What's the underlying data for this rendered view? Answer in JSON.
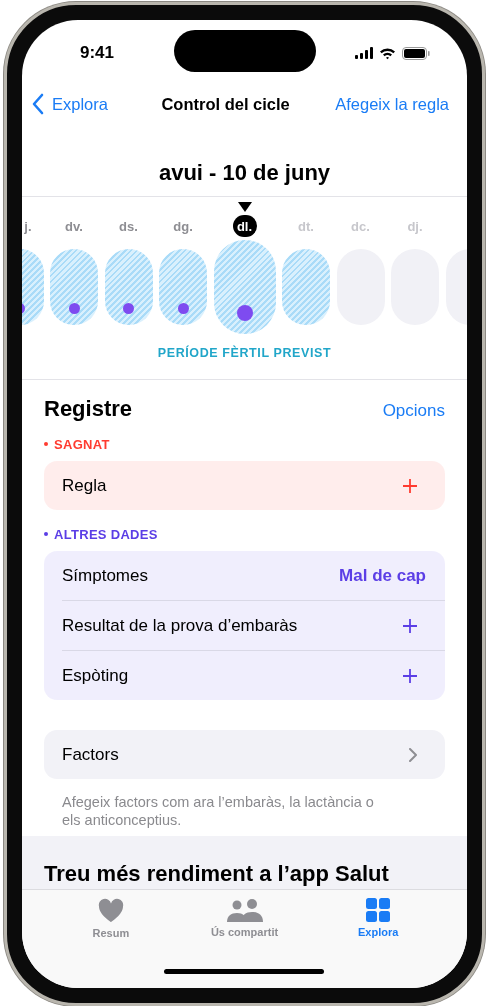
{
  "status_bar": {
    "time": "9:41"
  },
  "nav": {
    "back": "Explora",
    "title": "Control del cicle",
    "action": "Afegeix la regla"
  },
  "date_title": "avui - 10 de juny",
  "days": [
    {
      "label": "j.",
      "fertile": true,
      "logged": true,
      "selected": false,
      "future": false
    },
    {
      "label": "dv.",
      "fertile": true,
      "logged": true,
      "selected": false,
      "future": false
    },
    {
      "label": "ds.",
      "fertile": true,
      "logged": true,
      "selected": false,
      "future": false
    },
    {
      "label": "dg.",
      "fertile": true,
      "logged": true,
      "selected": false,
      "future": false
    },
    {
      "label": "dl.",
      "fertile": true,
      "logged": true,
      "selected": true,
      "future": false
    },
    {
      "label": "dt.",
      "fertile": true,
      "logged": false,
      "selected": false,
      "future": true
    },
    {
      "label": "dc.",
      "fertile": false,
      "logged": false,
      "selected": false,
      "future": true
    },
    {
      "label": "dj.",
      "fertile": false,
      "logged": false,
      "selected": false,
      "future": true
    },
    {
      "fertile": false,
      "logged": false,
      "selected": false,
      "future": true
    }
  ],
  "fertile_caption": "PERÍODE FÈRTIL PREVIST",
  "log": {
    "title": "Registre",
    "options": "Opcions",
    "sections": [
      {
        "title": "SAGNAT",
        "color": "#ff3b30",
        "rows": [
          {
            "label": "Regla",
            "kind": "add"
          }
        ]
      },
      {
        "title": "ALTRES DADES",
        "color": "#5b3ee6",
        "rows": [
          {
            "label": "Símptomes",
            "kind": "value",
            "value": "Mal de cap"
          },
          {
            "label": "Resultat de la prova d’embaràs",
            "kind": "add"
          },
          {
            "label": "Espòting",
            "kind": "add"
          }
        ]
      }
    ]
  },
  "factors": {
    "label": "Factors",
    "footnote": "Afegeix factors com ara l’embaràs, la lactància o els anticonceptius."
  },
  "promo": {
    "title": "Treu més rendiment a l’app Salut"
  },
  "tabs": [
    {
      "label": "Resum",
      "kind": "heart",
      "selected": false
    },
    {
      "label": "Ús compartit",
      "kind": "people",
      "selected": false
    },
    {
      "label": "Explora",
      "kind": "grid",
      "selected": true
    }
  ]
}
